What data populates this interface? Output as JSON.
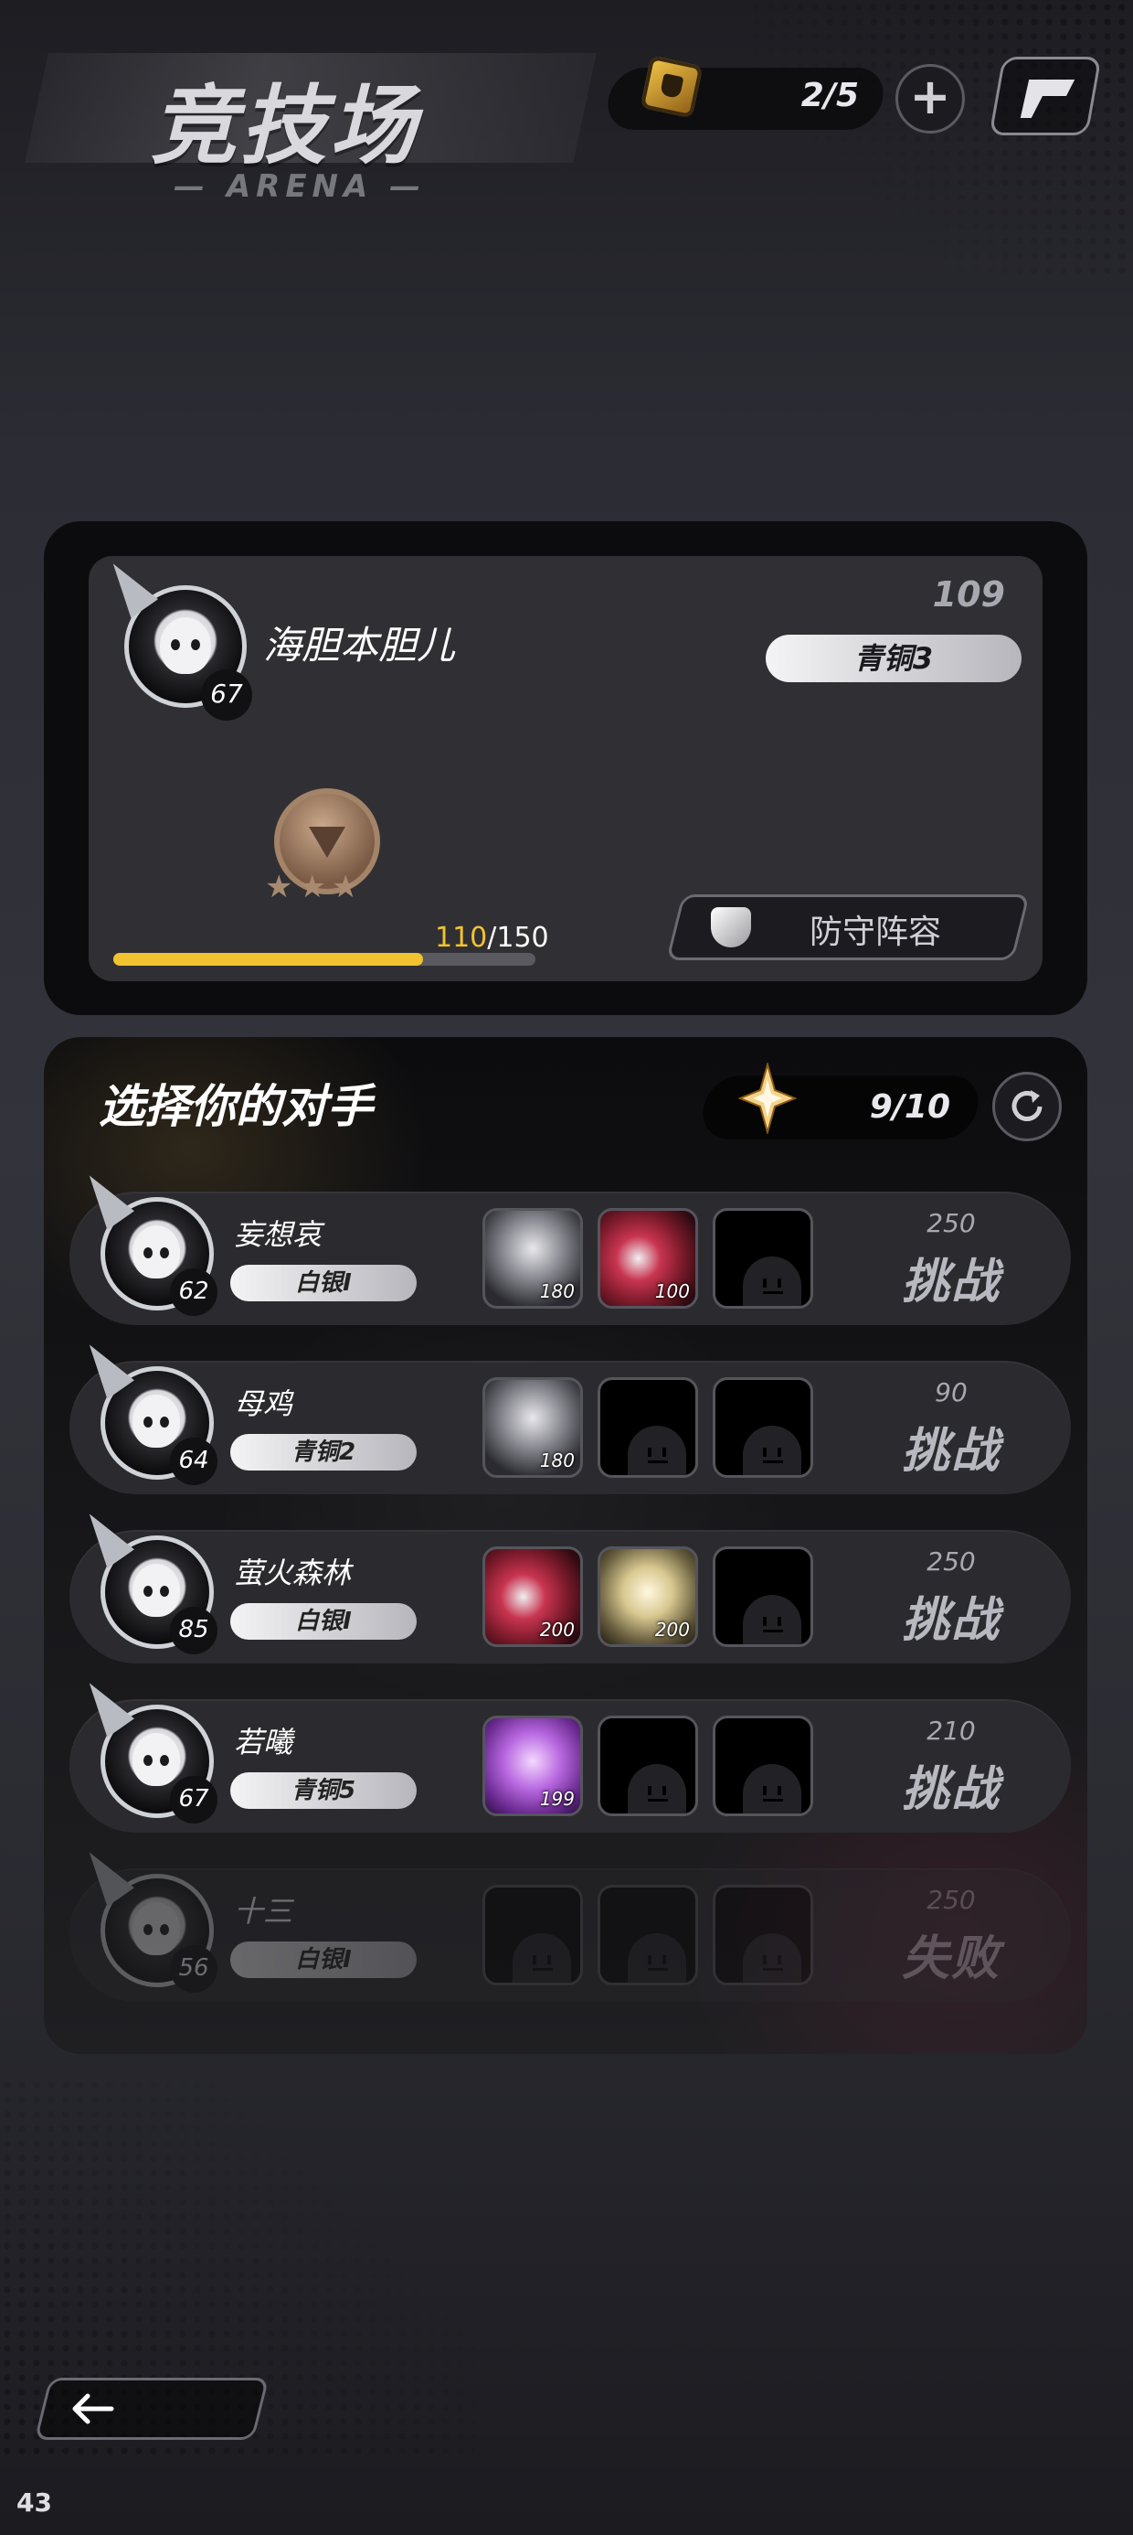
{
  "header": {
    "title": "竞技场",
    "subtitle": "— ARENA —",
    "tickets": "2/5",
    "plus_label": "+",
    "ticket_icon": "ticket-icon",
    "flag_icon": "flag-icon"
  },
  "profile": {
    "name": "海胆本胆儿",
    "level": "67",
    "score": "109",
    "rank": "青铜3",
    "rank_stars": "★★★",
    "xp_current": "110",
    "xp_max": "/150",
    "xp_progress": 0.733,
    "defense_label": "防守阵容"
  },
  "opponents": {
    "title": "选择你的对手",
    "refresh_count": "9/10",
    "refresh_icon": "refresh-icon",
    "list": [
      {
        "name": "妄想哀",
        "level": "62",
        "rank": "白银I",
        "reward": "250",
        "action": "挑战",
        "units": [
          "180",
          "100",
          ""
        ]
      },
      {
        "name": "母鸡",
        "level": "64",
        "rank": "青铜2",
        "reward": "90",
        "action": "挑战",
        "units": [
          "180",
          "",
          ""
        ]
      },
      {
        "name": "萤火森林",
        "level": "85",
        "rank": "白银I",
        "reward": "250",
        "action": "挑战",
        "units": [
          "200",
          "200",
          ""
        ]
      },
      {
        "name": "若曦",
        "level": "67",
        "rank": "青铜5",
        "reward": "210",
        "action": "挑战",
        "units": [
          "199",
          "",
          ""
        ]
      },
      {
        "name": "十三",
        "level": "56",
        "rank": "白银I",
        "reward": "250",
        "action": "失败",
        "units": [
          "",
          "",
          ""
        ]
      }
    ]
  },
  "footer": {
    "back_icon": "back-arrow-icon",
    "fps": "43"
  },
  "colors": {
    "accent_yellow": "#f2c230",
    "panel_dark": "#0c0c0e",
    "panel_mid": "#303034"
  }
}
